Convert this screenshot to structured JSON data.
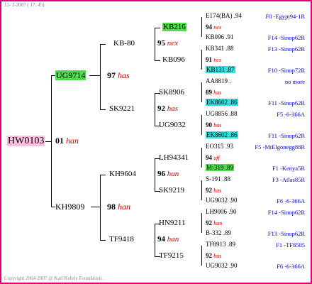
{
  "header": {
    "date": "11-  2-2007 ( 17: 45)"
  },
  "footer": {
    "copyright": "Copyright 2004-2007 @ Karl Kehrle Foundation."
  },
  "gen1": {
    "ring": "HW0103",
    "year": "01",
    "code": "han"
  },
  "gen2": [
    {
      "ring": "UG9714"
    },
    {
      "ring": "KH9809"
    }
  ],
  "gen3": [
    {
      "ring": "KB-80"
    },
    {
      "ring": "SK9221"
    },
    {
      "ring": "KH9604"
    },
    {
      "ring": "TF9418"
    }
  ],
  "gen3_mid": [
    {
      "year": "97",
      "code": "has"
    },
    {
      "year": "98",
      "code": "han"
    }
  ],
  "gen4": [
    {
      "ring": "KB216"
    },
    {
      "ring": "KB096"
    },
    {
      "ring": "SK8906"
    },
    {
      "ring": "UG9032"
    },
    {
      "ring": "LH94341"
    },
    {
      "ring": "SK9219"
    },
    {
      "ring": "HN9211"
    },
    {
      "ring": "TF9215"
    }
  ],
  "gen4_mid": [
    {
      "year": "95",
      "code": "nex"
    },
    {
      "year": "92",
      "code": "has"
    },
    {
      "year": "96",
      "code": "han"
    },
    {
      "year": "94",
      "code": "han"
    }
  ],
  "gen5": [
    {
      "sire": "E174(BA) .94",
      "mid_year": "94",
      "mid_code": "nex",
      "dam": "KB096 .91",
      "sire_info": "F0 -Egypt94-1R",
      "dam_info": "F14 -Sinop62R"
    },
    {
      "sire": "KB341 .88",
      "mid_year": "91",
      "mid_code": "nex",
      "dam": "KB131 .87",
      "sire_info": "F13 -Sinop62R",
      "dam_info": "F10 -Sinop72R"
    },
    {
      "sire": "AA8819 .",
      "mid_year": "89",
      "mid_code": "has",
      "dam": "EK8602 .86",
      "sire_info": "no more",
      "dam_info": "F11 -Sinop62R"
    },
    {
      "sire": "UG8856 .88",
      "mid_year": "90",
      "mid_code": "has",
      "dam": "EK8602 .86",
      "sire_info": "F5 -6-366A",
      "dam_info": "F11 -Sinop62R"
    },
    {
      "sire": "EO315 .93",
      "mid_year": "94",
      "mid_code": "uff",
      "dam": "M-319 .89",
      "sire_info": "F5 -MtElgonegg88R",
      "dam_info": "F1 -Kenya5R"
    },
    {
      "sire": "S-191 .88",
      "mid_year": "92",
      "mid_code": "has",
      "dam": "UG9032 .90",
      "sire_info": "F3 -Atlas85R",
      "dam_info": "F6 -6-366A"
    },
    {
      "sire": "LH9006 .90",
      "mid_year": "92",
      "mid_code": "han",
      "dam": "B-332 .89",
      "sire_info": "F14 -Sinop62R",
      "dam_info": "F13 -Sinop62R"
    },
    {
      "sire": "TF8913 .89",
      "mid_year": "92",
      "mid_code": "has",
      "dam": "UG9032 .90",
      "sire_info": "F1 -TF8505",
      "dam_info": "F6 -6-366A"
    }
  ],
  "colors": {
    "border": "#e0007a",
    "code": "#d40000",
    "info": "#0000cc",
    "highlight_green": "#4cdc4c",
    "highlight_cyan": "#2fe0e0",
    "highlight_pink": "#ffc0e0"
  }
}
